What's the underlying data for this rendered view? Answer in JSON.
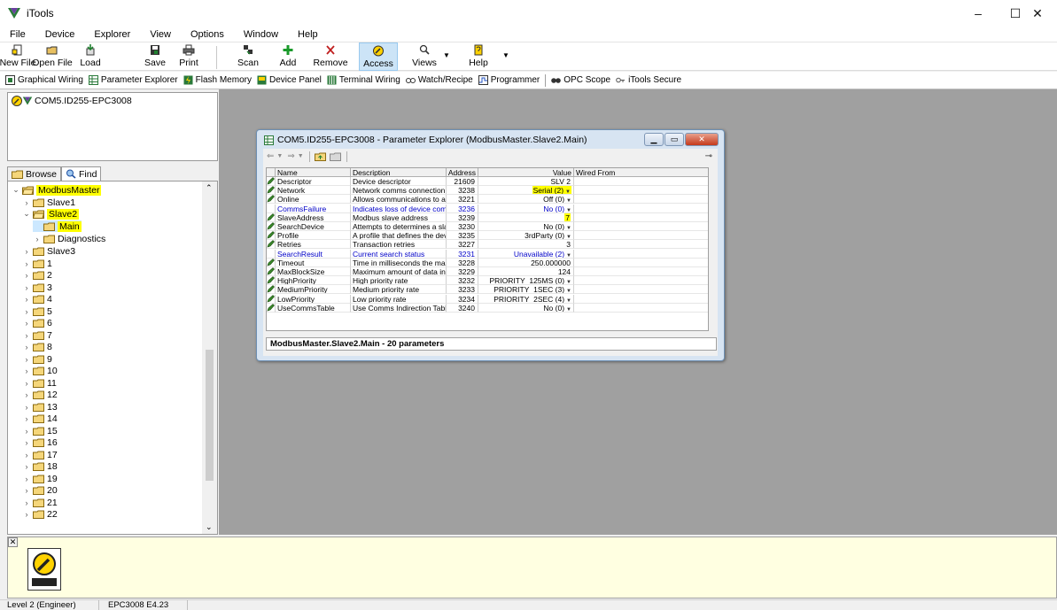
{
  "window": {
    "title": "iTools",
    "minimize": "–",
    "maximize": "☐",
    "close": "✕"
  },
  "menu": [
    "File",
    "Device",
    "Explorer",
    "View",
    "Options",
    "Window",
    "Help"
  ],
  "toolbar": {
    "new_file": "New File",
    "open_file": "Open File",
    "load": "Load",
    "save": "Save",
    "print": "Print",
    "scan": "Scan",
    "add": "Add",
    "remove": "Remove",
    "access": "Access",
    "views": "Views",
    "help": "Help"
  },
  "links": [
    "Graphical Wiring",
    "Parameter Explorer",
    "Flash Memory",
    "Device Panel",
    "Terminal Wiring",
    "Watch/Recipe",
    "Programmer",
    "OPC Scope",
    "iTools Secure"
  ],
  "device": {
    "name": "COM5.ID255-EPC3008"
  },
  "tabs": {
    "browse": "Browse",
    "find": "Find"
  },
  "tree": {
    "modbus_master": "ModbusMaster",
    "slave1": "Slave1",
    "slave2": "Slave2",
    "main": "Main",
    "diagnostics": "Diagnostics",
    "slave3": "Slave3",
    "numbered": [
      "1",
      "2",
      "3",
      "4",
      "5",
      "6",
      "7",
      "8",
      "9",
      "10",
      "11",
      "12",
      "13",
      "14",
      "15",
      "16",
      "17",
      "18",
      "19",
      "20",
      "21",
      "22"
    ]
  },
  "param_explorer": {
    "title": "COM5.ID255-EPC3008 - Parameter Explorer (ModbusMaster.Slave2.Main)",
    "columns": {
      "name": "Name",
      "description": "Description",
      "address": "Address",
      "value": "Value",
      "wired_from": "Wired From"
    },
    "rows": [
      {
        "name": "Descriptor",
        "description": "Device descriptor",
        "address": "21609",
        "value": "SLV 2",
        "dropdown": false,
        "blue": false,
        "highlight": false,
        "icon": true
      },
      {
        "name": "Network",
        "description": "Network comms connection",
        "address": "3238",
        "value": "Serial (2)",
        "dropdown": true,
        "blue": false,
        "highlight": true,
        "icon": true
      },
      {
        "name": "Online",
        "description": "Allows communications to a s",
        "address": "3221",
        "value": "Off (0)",
        "dropdown": true,
        "blue": false,
        "highlight": false,
        "icon": true
      },
      {
        "name": "CommsFailure",
        "description": "Indicates loss of device comi",
        "address": "3236",
        "value": "No (0)",
        "dropdown": true,
        "blue": true,
        "highlight": false,
        "icon": false
      },
      {
        "name": "SlaveAddress",
        "description": "Modbus slave address",
        "address": "3239",
        "value": "7",
        "dropdown": false,
        "blue": false,
        "highlight": true,
        "icon": true
      },
      {
        "name": "SearchDevice",
        "description": "Attempts to determines a slav",
        "address": "3230",
        "value": "No (0)",
        "dropdown": true,
        "blue": false,
        "highlight": false,
        "icon": true
      },
      {
        "name": "Profile",
        "description": "A profile that defines the dev",
        "address": "3235",
        "value": "3rdParty (0)",
        "dropdown": true,
        "blue": false,
        "highlight": false,
        "icon": true
      },
      {
        "name": "Retries",
        "description": "Transaction retries",
        "address": "3227",
        "value": "3",
        "dropdown": false,
        "blue": false,
        "highlight": false,
        "icon": true
      },
      {
        "name": "SearchResult",
        "description": "Current search status",
        "address": "3231",
        "value": "Unavailable (2)",
        "dropdown": true,
        "blue": true,
        "highlight": false,
        "icon": false
      },
      {
        "name": "Timeout",
        "description": "Time in milliseconds the mast",
        "address": "3228",
        "value": "250.000000",
        "dropdown": false,
        "blue": false,
        "highlight": false,
        "icon": true
      },
      {
        "name": "MaxBlockSize",
        "description": "Maximum amount of data in a",
        "address": "3229",
        "value": "124",
        "dropdown": false,
        "blue": false,
        "highlight": false,
        "icon": true
      },
      {
        "name": "HighPriority",
        "description": "High priority rate",
        "address": "3232",
        "value": "PRIORITY_125MS (0)",
        "dropdown": true,
        "blue": false,
        "highlight": false,
        "icon": true
      },
      {
        "name": "MediumPriority",
        "description": "Medium priority rate",
        "address": "3233",
        "value": "PRIORITY_1SEC (3)",
        "dropdown": true,
        "blue": false,
        "highlight": false,
        "icon": true
      },
      {
        "name": "LowPriority",
        "description": "Low priority rate",
        "address": "3234",
        "value": "PRIORITY_2SEC (4)",
        "dropdown": true,
        "blue": false,
        "highlight": false,
        "icon": true
      },
      {
        "name": "UseCommsTable",
        "description": "Use Comms Indirection Table",
        "address": "3240",
        "value": "No (0)",
        "dropdown": true,
        "blue": false,
        "highlight": false,
        "icon": true
      }
    ],
    "status": "ModbusMaster.Slave2.Main  -  20 parameters"
  },
  "statusbar": {
    "level": "Level 2 (Engineer)",
    "version": "EPC3008 E4.23"
  },
  "colors": {
    "highlight": "#ffff00",
    "link_blue": "#0000c8",
    "workspace": "#a0a0a0",
    "tip_pane": "#ffffe1"
  }
}
